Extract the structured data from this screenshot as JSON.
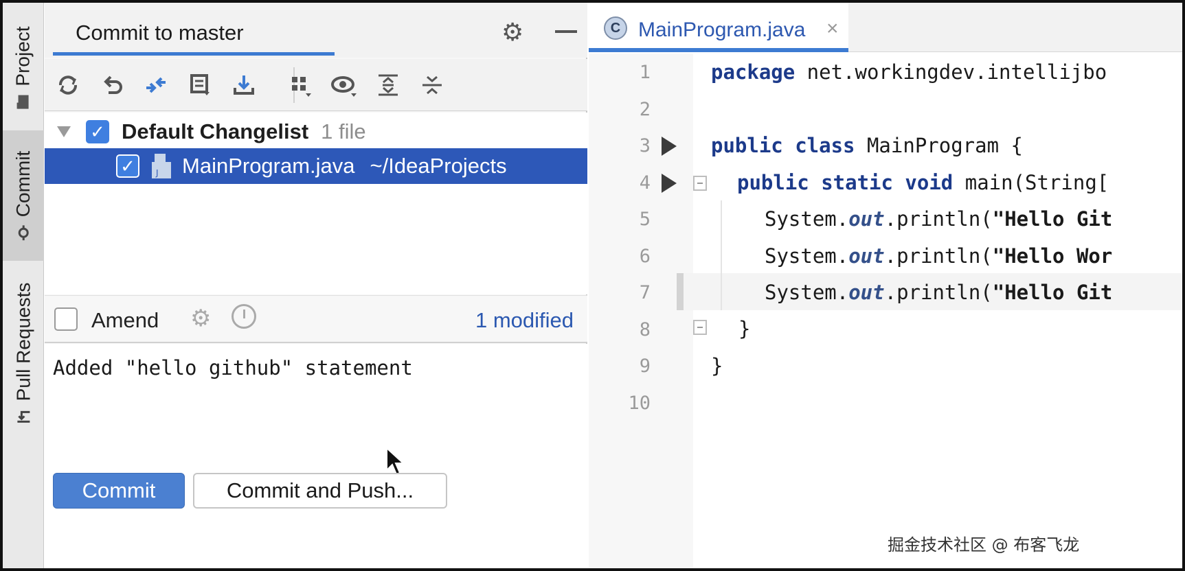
{
  "sidebar": {
    "tabs": [
      {
        "label": "Project",
        "icon": "folder-icon",
        "active": false
      },
      {
        "label": "Commit",
        "icon": "commit-node-icon",
        "active": true
      },
      {
        "label": "Pull Requests",
        "icon": "pull-request-icon",
        "active": false
      }
    ]
  },
  "commit_panel": {
    "title": "Commit to master",
    "toolbar": [
      "refresh-icon",
      "rollback-icon",
      "diff-icon",
      "shelve-icon",
      "update-icon",
      "group-by-icon",
      "view-options-icon",
      "expand-all-icon",
      "collapse-all-icon"
    ],
    "changelist": {
      "name": "Default Changelist",
      "count": "1 file",
      "files": [
        {
          "name": "MainProgram.java",
          "path": "~/IdeaProjects",
          "checked": true
        }
      ]
    },
    "amend_label": "Amend",
    "modified_label": "1 modified",
    "message": "Added \"hello github\" statement",
    "commit_button": "Commit",
    "commit_push_button": "Commit and Push..."
  },
  "editor": {
    "tab_title": "MainProgram.java",
    "tab_icon_letter": "C",
    "current_line": 7,
    "line_numbers": [
      "1",
      "2",
      "3",
      "4",
      "5",
      "6",
      "7",
      "8",
      "9",
      "10"
    ],
    "code": {
      "l1_kw": "package",
      "l1_rest": " net.workingdev.intellijbo",
      "l3_kw": "public class",
      "l3_rest": " MainProgram {",
      "l4_kw": "public static void",
      "l4_rest": " main(String[",
      "l5_a": "System.",
      "l5_b": "out",
      "l5_c": ".println(",
      "l5_d": "\"Hello Git",
      "l6_a": "System.",
      "l6_b": "out",
      "l6_c": ".println(",
      "l6_d": "\"Hello Wor",
      "l7_a": "System.",
      "l7_b": "out",
      "l7_c": ".println(",
      "l7_d": "\"Hello Git",
      "l8": "}",
      "l9": "}"
    }
  },
  "watermark": "掘金技术社区 @ 布客飞龙",
  "colors": {
    "accent": "#3d7bd2",
    "selection": "#2d58b8",
    "keyword": "#1c3a8a",
    "commit_button": "#4b80d1"
  }
}
